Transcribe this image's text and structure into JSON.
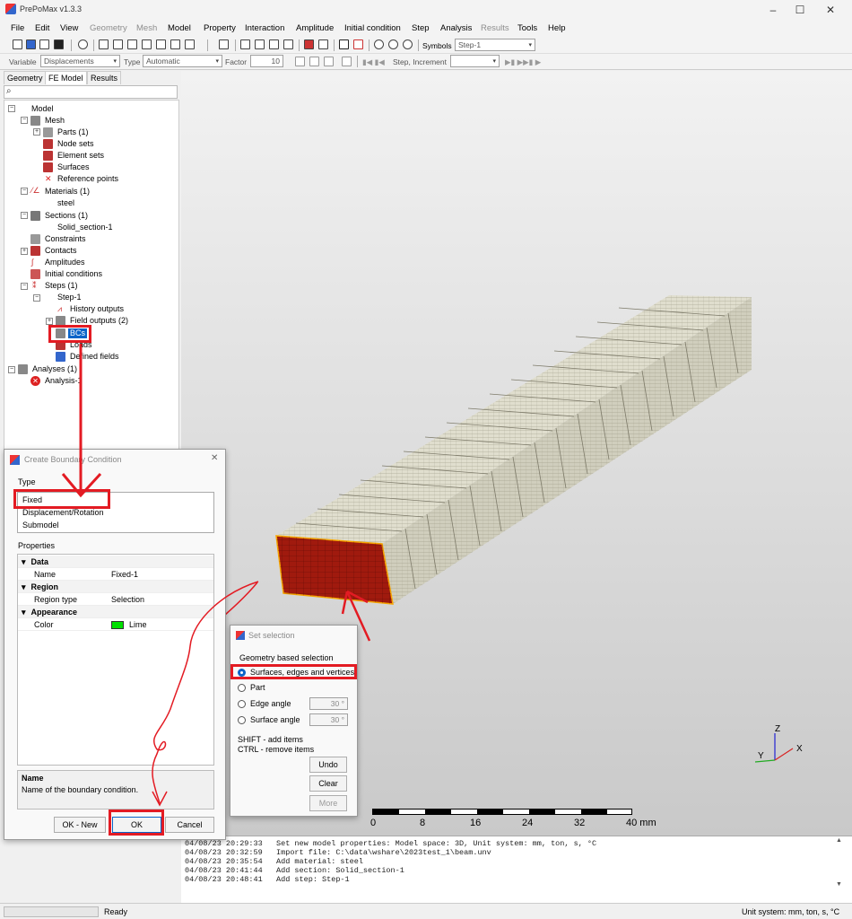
{
  "app": {
    "title": "PrePoMax v1.3.3",
    "minimize": "–",
    "maximize": "☐",
    "close": "✕"
  },
  "menu": [
    {
      "label": "File",
      "dim": false
    },
    {
      "label": "Edit",
      "dim": false
    },
    {
      "label": "View",
      "dim": false
    },
    {
      "label": "Geometry",
      "dim": true
    },
    {
      "label": "Mesh",
      "dim": true
    },
    {
      "label": "Model",
      "dim": false
    },
    {
      "label": "Property",
      "dim": false
    },
    {
      "label": "Interaction",
      "dim": false
    },
    {
      "label": "Amplitude",
      "dim": false
    },
    {
      "label": "Initial condition",
      "dim": false
    },
    {
      "label": "Step",
      "dim": false
    },
    {
      "label": "Analysis",
      "dim": false
    },
    {
      "label": "Results",
      "dim": true
    },
    {
      "label": "Tools",
      "dim": false
    },
    {
      "label": "Help",
      "dim": false
    }
  ],
  "toolbar1": {
    "symbols_label": "Symbols",
    "step_value": "Step-1"
  },
  "toolbar2": {
    "variable_label": "Variable",
    "variable_value": "Displacements",
    "type_label": "Type",
    "type_value": "Automatic",
    "factor_label": "Factor",
    "factor_value": "10",
    "step_increment_label": "Step, Increment"
  },
  "tabs": {
    "geometry": "Geometry",
    "fe_model": "FE Model",
    "results": "Results"
  },
  "tree": {
    "model": "Model",
    "mesh": "Mesh",
    "parts": "Parts (1)",
    "node_sets": "Node sets",
    "element_sets": "Element sets",
    "surfaces": "Surfaces",
    "reference_points": "Reference points",
    "materials": "Materials (1)",
    "steel": "steel",
    "sections": "Sections (1)",
    "solid_section": "Solid_section-1",
    "constraints": "Constraints",
    "contacts": "Contacts",
    "amplitudes": "Amplitudes",
    "initial_conditions": "Initial conditions",
    "steps": "Steps (1)",
    "step1": "Step-1",
    "history_outputs": "History outputs",
    "field_outputs": "Field outputs (2)",
    "bcs": "BCs",
    "loads": "Loads",
    "defined_fields": "Defined fields",
    "analyses": "Analyses (1)",
    "analysis1": "Analysis-1"
  },
  "bc_dialog": {
    "title": "Create Boundary Condition",
    "type_label": "Type",
    "types": [
      "Fixed",
      "Displacement/Rotation",
      "Submodel"
    ],
    "properties_label": "Properties",
    "data_cat": "Data",
    "name_key": "Name",
    "name_val": "Fixed-1",
    "region_cat": "Region",
    "region_type_key": "Region type",
    "region_type_val": "Selection",
    "appearance_cat": "Appearance",
    "color_key": "Color",
    "color_val": "Lime",
    "color_hex": "#00e000",
    "desc_title": "Name",
    "desc_text": "Name of the boundary condition.",
    "ok_new": "OK - New",
    "ok": "OK",
    "cancel": "Cancel"
  },
  "sel_dialog": {
    "title": "Set selection",
    "group_label": "Geometry based selection",
    "opt_surfaces": "Surfaces, edges and vertices",
    "opt_part": "Part",
    "opt_edge": "Edge angle",
    "edge_val": "30 °",
    "opt_surface_angle": "Surface angle",
    "surface_val": "30 °",
    "hint1": "SHIFT - add items",
    "hint2": "CTRL - remove items",
    "undo": "Undo",
    "clear": "Clear",
    "more": "More"
  },
  "scale": {
    "ticks": [
      "0",
      "8",
      "16",
      "24",
      "32",
      "40 mm"
    ]
  },
  "axes": {
    "z": "Z",
    "y": "Y",
    "x": "X"
  },
  "console": [
    "04/08/23 20:29:33   Set new model properties: Model space: 3D, Unit system: mm, ton, s, °C",
    "04/08/23 20:32:59   Import file: C:\\data\\wshare\\2023test_1\\beam.unv",
    "04/08/23 20:35:54   Add material: steel",
    "04/08/23 20:41:44   Add section: Solid_section-1",
    "04/08/23 20:48:41   Add step: Step-1"
  ],
  "status": {
    "ready": "Ready",
    "units": "Unit system: mm, ton, s, °C"
  },
  "colors": {
    "annotation": "#e31b23",
    "beam_face": "#d6d4c4",
    "beam_selected": "#a01a0e"
  }
}
